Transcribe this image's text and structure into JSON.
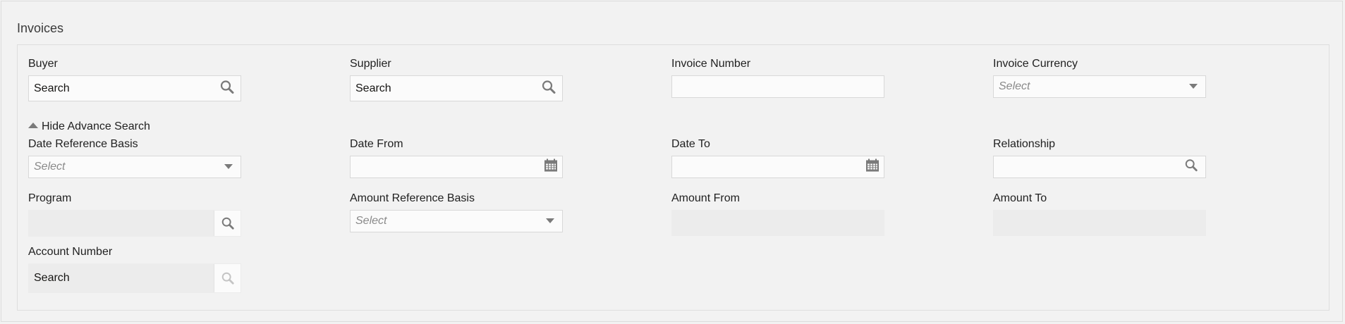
{
  "section": {
    "title": "Invoices"
  },
  "fields": {
    "buyer": {
      "label": "Buyer",
      "value": "Search"
    },
    "supplier": {
      "label": "Supplier",
      "value": "Search"
    },
    "invoice_number": {
      "label": "Invoice Number",
      "value": ""
    },
    "invoice_currency": {
      "label": "Invoice Currency",
      "placeholder": "Select"
    },
    "advance_toggle": {
      "label": "Hide Advance Search"
    },
    "date_reference_basis": {
      "label": "Date Reference Basis",
      "placeholder": "Select"
    },
    "date_from": {
      "label": "Date From",
      "value": ""
    },
    "date_to": {
      "label": "Date To",
      "value": ""
    },
    "relationship": {
      "label": "Relationship",
      "value": ""
    },
    "program": {
      "label": "Program",
      "value": ""
    },
    "amount_reference_basis": {
      "label": "Amount Reference Basis",
      "placeholder": "Select"
    },
    "amount_from": {
      "label": "Amount From",
      "value": ""
    },
    "amount_to": {
      "label": "Amount To",
      "value": ""
    },
    "account_number": {
      "label": "Account Number",
      "value": "Search"
    }
  },
  "icons": {
    "search": "search-icon",
    "calendar": "calendar-icon",
    "dropdown": "chevron-down-icon",
    "collapse": "triangle-up-icon"
  },
  "colors": {
    "background": "#f2f2f2",
    "field": "#fbfbfb",
    "disabled_field": "#ececec",
    "icon": "#7a7a7a"
  }
}
